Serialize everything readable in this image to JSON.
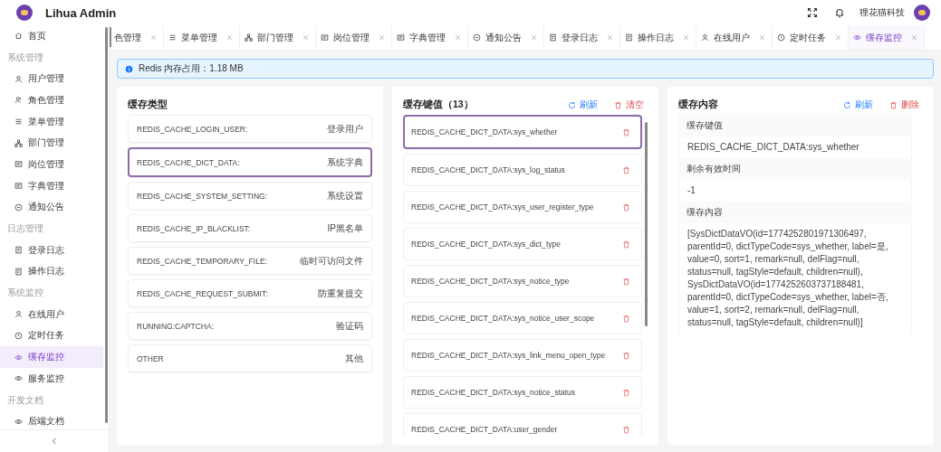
{
  "header": {
    "app_name": "Lihua Admin",
    "company": "狸花猫科技"
  },
  "sidebar": {
    "entries": [
      {
        "kind": "item",
        "label": "首页",
        "selected": false
      },
      {
        "kind": "group",
        "label": "系统管理"
      },
      {
        "kind": "item",
        "label": "用户管理",
        "selected": false
      },
      {
        "kind": "item",
        "label": "角色管理",
        "selected": false
      },
      {
        "kind": "item",
        "label": "菜单管理",
        "selected": false
      },
      {
        "kind": "item",
        "label": "部门管理",
        "selected": false
      },
      {
        "kind": "item",
        "label": "岗位管理",
        "selected": false
      },
      {
        "kind": "item",
        "label": "字典管理",
        "selected": false
      },
      {
        "kind": "item",
        "label": "通知公告",
        "selected": false
      },
      {
        "kind": "group",
        "label": "日志管理"
      },
      {
        "kind": "item",
        "label": "登录日志",
        "selected": false
      },
      {
        "kind": "item",
        "label": "操作日志",
        "selected": false
      },
      {
        "kind": "group",
        "label": "系统监控"
      },
      {
        "kind": "item",
        "label": "在线用户",
        "selected": false
      },
      {
        "kind": "item",
        "label": "定时任务",
        "selected": false
      },
      {
        "kind": "item",
        "label": "缓存监控",
        "selected": true
      },
      {
        "kind": "item",
        "label": "服务监控",
        "selected": false
      },
      {
        "kind": "group",
        "label": "开发文档"
      },
      {
        "kind": "item",
        "label": "后端文档",
        "selected": false
      }
    ]
  },
  "tabs": [
    {
      "label": "色管理",
      "selected": false
    },
    {
      "label": "菜单管理",
      "selected": false
    },
    {
      "label": "部门管理",
      "selected": false
    },
    {
      "label": "岗位管理",
      "selected": false
    },
    {
      "label": "字典管理",
      "selected": false
    },
    {
      "label": "通知公告",
      "selected": false
    },
    {
      "label": "登录日志",
      "selected": false
    },
    {
      "label": "操作日志",
      "selected": false
    },
    {
      "label": "在线用户",
      "selected": false
    },
    {
      "label": "定时任务",
      "selected": false
    },
    {
      "label": "缓存监控",
      "selected": true
    }
  ],
  "alert": "Redis 内存占用：1.18 MB",
  "cache_types": {
    "title": "缓存类型",
    "items": [
      {
        "key": "REDIS_CACHE_LOGIN_USER:",
        "name": "登录用户",
        "selected": false
      },
      {
        "key": "REDIS_CACHE_DICT_DATA:",
        "name": "系统字典",
        "selected": true
      },
      {
        "key": "REDIS_CACHE_SYSTEM_SETTING:",
        "name": "系统设置",
        "selected": false
      },
      {
        "key": "REDIS_CACHE_IP_BLACKLIST:",
        "name": "IP黑名单",
        "selected": false
      },
      {
        "key": "REDIS_CACHE_TEMPORARY_FILE:",
        "name": "临时可访问文件",
        "selected": false
      },
      {
        "key": "REDIS_CACHE_REQUEST_SUBMIT:",
        "name": "防重复提交",
        "selected": false
      },
      {
        "key": "RUNNING:CAPTCHA:",
        "name": "验证码",
        "selected": false
      },
      {
        "key": "OTHER",
        "name": "其他",
        "selected": false
      }
    ]
  },
  "cache_keys": {
    "title": "缓存键值（13）",
    "refresh": "刷新",
    "clear": "清空",
    "items": [
      {
        "key": "REDIS_CACHE_DICT_DATA:sys_whether",
        "selected": true
      },
      {
        "key": "REDIS_CACHE_DICT_DATA:sys_log_status",
        "selected": false
      },
      {
        "key": "REDIS_CACHE_DICT_DATA:sys_user_register_type",
        "selected": false
      },
      {
        "key": "REDIS_CACHE_DICT_DATA:sys_dict_type",
        "selected": false
      },
      {
        "key": "REDIS_CACHE_DICT_DATA:sys_notice_type",
        "selected": false
      },
      {
        "key": "REDIS_CACHE_DICT_DATA:sys_notice_user_scope",
        "selected": false
      },
      {
        "key": "REDIS_CACHE_DICT_DATA:sys_link_menu_open_type",
        "selected": false
      },
      {
        "key": "REDIS_CACHE_DICT_DATA:sys_notice_status",
        "selected": false
      },
      {
        "key": "REDIS_CACHE_DICT_DATA:user_gender",
        "selected": false
      }
    ]
  },
  "cache_content": {
    "title": "缓存内容",
    "refresh": "刷新",
    "delete": "删除",
    "fields": [
      {
        "label": "缓存键值",
        "value": "REDIS_CACHE_DICT_DATA:sys_whether"
      },
      {
        "label": "剩余有效时间",
        "value": "-1"
      },
      {
        "label": "缓存内容",
        "value": "[SysDictDataVO(id=1774252801971306497, parentId=0, dictTypeCode=sys_whether, label=是, value=0, sort=1, remark=null, delFlag=null, status=null, tagStyle=default, children=null), SysDictDataVO(id=1774252603737188481, parentId=0, dictTypeCode=sys_whether, label=否, value=1, sort=2, remark=null, delFlag=null, status=null, tagStyle=default, children=null)]"
      }
    ]
  }
}
